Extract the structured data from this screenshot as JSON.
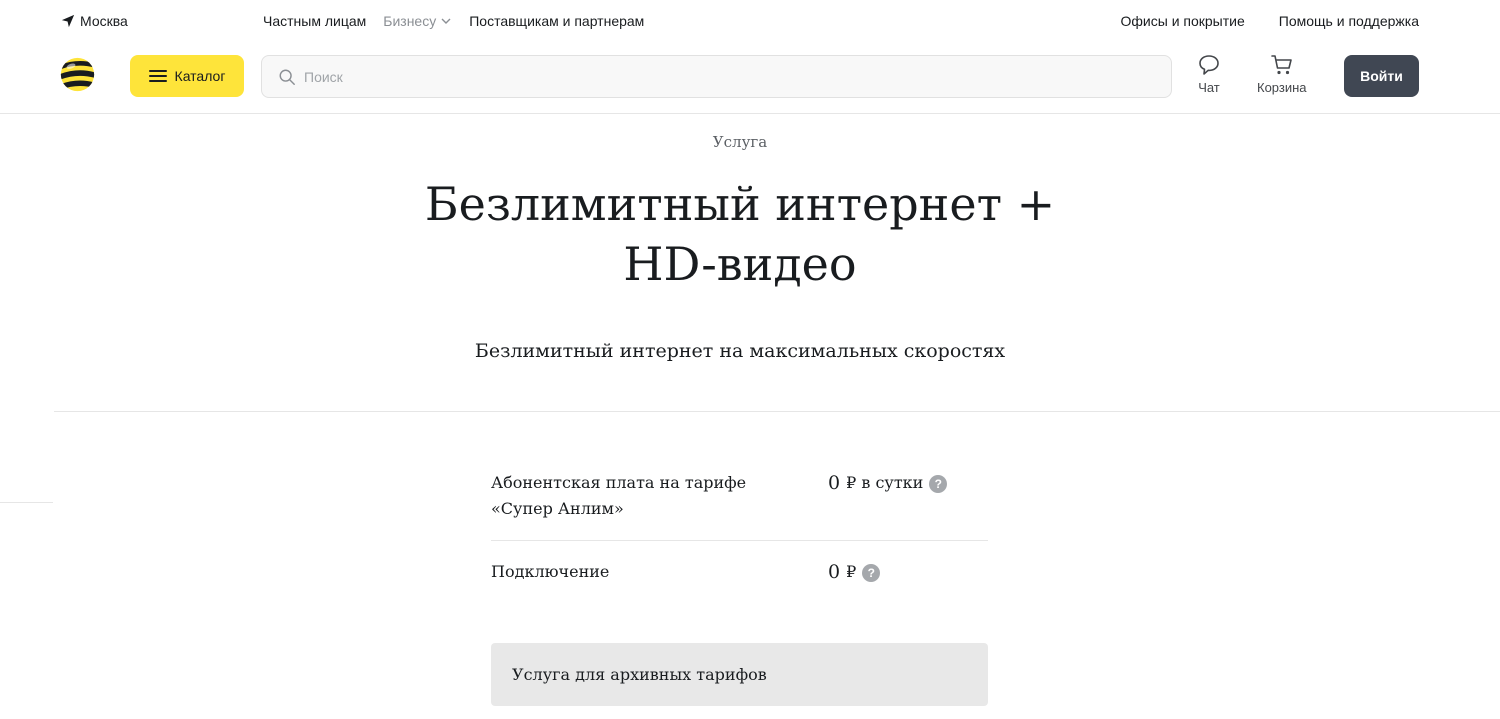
{
  "topbar": {
    "city": "Москва",
    "segments": [
      {
        "label": "Частным лицам",
        "active": true
      },
      {
        "label": "Бизнесу",
        "active": false
      },
      {
        "label": "Поставщикам и партнерам",
        "active": true
      }
    ],
    "right_links": [
      "Офисы и покрытие",
      "Помощь и поддержка"
    ]
  },
  "header": {
    "catalog_label": "Каталог",
    "search_placeholder": "Поиск",
    "chat_label": "Чат",
    "cart_label": "Корзина",
    "login_label": "Войти",
    "colors": {
      "brand_yellow": "#fee43a",
      "login_bg": "#404753"
    }
  },
  "main": {
    "eyebrow": "Услуга",
    "title": "Безлимитный интернет + HD-видео",
    "subtitle": "Безлимитный интернет на максимальных скоростях",
    "prices": [
      {
        "label": "Абонентская плата на тарифе «Супер Анлим»",
        "amount": "0",
        "unit": "₽ в сутки"
      },
      {
        "label": "Подключение",
        "amount": "0",
        "unit": "₽"
      }
    ],
    "help_glyph": "?",
    "archive_note": "Услуга для архивных тарифов"
  }
}
